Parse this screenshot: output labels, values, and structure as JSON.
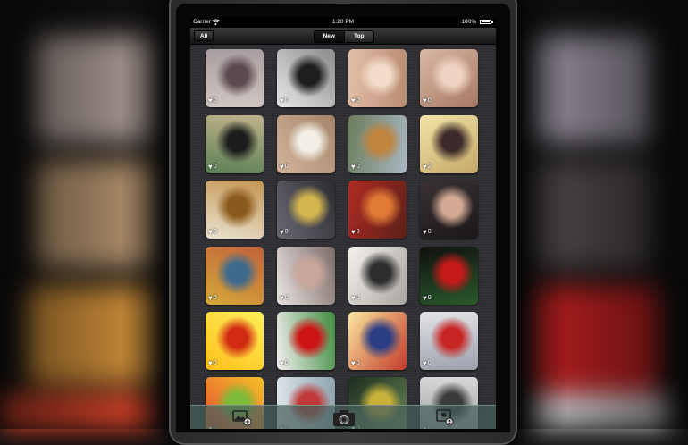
{
  "status": {
    "carrier": "Carrier",
    "time": "1:20 PM",
    "battery": "100%",
    "battery_level": 1.0
  },
  "toolbar": {
    "all_label": "All",
    "segments": [
      {
        "label": "New",
        "selected": true
      },
      {
        "label": "Top",
        "selected": false
      }
    ]
  },
  "photos": [
    {
      "likes": "0",
      "palette": [
        "#cfc6c2",
        "#5b4a4e",
        "#a89ea0"
      ]
    },
    {
      "likes": "0",
      "palette": [
        "#e8e8e8",
        "#1e1e1e",
        "#8a8a8a"
      ]
    },
    {
      "likes": "0",
      "palette": [
        "#e3bfa7",
        "#f2dcc9",
        "#b88b72"
      ]
    },
    {
      "likes": "0",
      "palette": [
        "#d9b8a4",
        "#f0d3c3",
        "#a67862"
      ]
    },
    {
      "likes": "0",
      "palette": [
        "#5c7f55",
        "#1d1d1d",
        "#c0b38c"
      ]
    },
    {
      "likes": "0",
      "palette": [
        "#d2b49c",
        "#f3efe6",
        "#a58468"
      ]
    },
    {
      "likes": "0",
      "palette": [
        "#6b7c5c",
        "#c0843e",
        "#aab7c2"
      ]
    },
    {
      "likes": "2",
      "palette": [
        "#f2e4a8",
        "#3d2b2b",
        "#c5a868"
      ]
    },
    {
      "likes": "0",
      "palette": [
        "#e9e3d2",
        "#8a5a1c",
        "#c49450"
      ]
    },
    {
      "likes": "0",
      "palette": [
        "#6b6a73",
        "#d4b64e",
        "#2b2b31"
      ]
    },
    {
      "likes": "0",
      "palette": [
        "#b02b23",
        "#e07a36",
        "#5a2018"
      ]
    },
    {
      "likes": "0",
      "palette": [
        "#3a3234",
        "#d4aa95",
        "#1b1718"
      ]
    },
    {
      "likes": "0",
      "palette": [
        "#d5aa3a",
        "#3e6a8e",
        "#c2613a"
      ]
    },
    {
      "likes": "0",
      "palette": [
        "#eae6e4",
        "#c9a69a",
        "#7b6a66"
      ]
    },
    {
      "likes": "0",
      "palette": [
        "#f3f1ee",
        "#2e2e2e",
        "#a9a5a0"
      ]
    },
    {
      "likes": "0",
      "palette": [
        "#0f0f0f",
        "#c51a1a",
        "#2b5a2b"
      ]
    },
    {
      "likes": "0",
      "palette": [
        "#ffbf1a",
        "#d02a12",
        "#fff05a"
      ]
    },
    {
      "likes": "0",
      "palette": [
        "#f5f0f2",
        "#cc1414",
        "#3d8c3d"
      ]
    },
    {
      "likes": "0",
      "palette": [
        "#fbe7a0",
        "#2b3e85",
        "#c23a2a"
      ]
    },
    {
      "likes": "0",
      "palette": [
        "#e4e4e8",
        "#c72424",
        "#9aa0ab"
      ]
    },
    {
      "likes": "0",
      "palette": [
        "#e6452e",
        "#7dbb3a",
        "#f4c22a"
      ]
    },
    {
      "likes": "0",
      "palette": [
        "#dfe6ea",
        "#c03a3a",
        "#8ea3ae"
      ]
    },
    {
      "likes": "0",
      "palette": [
        "#1e2b1e",
        "#c9b23a",
        "#6a8b5a"
      ]
    },
    {
      "likes": "0",
      "palette": [
        "#9a9a9a",
        "#3a3a3a",
        "#d8d8d8"
      ]
    }
  ],
  "tabbar": {
    "tabs": [
      {
        "icon": "gallery-icon"
      },
      {
        "icon": "camera-icon"
      },
      {
        "icon": "profile-icon"
      }
    ]
  }
}
